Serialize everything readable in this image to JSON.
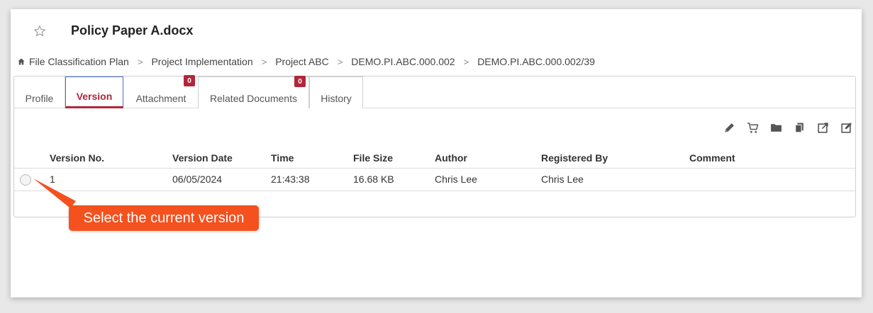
{
  "document": {
    "title": "Policy Paper A.docx"
  },
  "breadcrumb": [
    {
      "label": "File Classification Plan"
    },
    {
      "label": "Project Implementation"
    },
    {
      "label": "Project ABC"
    },
    {
      "label": "DEMO.PI.ABC.000.002"
    },
    {
      "label": "DEMO.PI.ABC.000.002/39"
    }
  ],
  "breadcrumb_separator": ">",
  "tabs": [
    {
      "label": "Profile"
    },
    {
      "label": "Version"
    },
    {
      "label": "Attachment",
      "badge": "0"
    },
    {
      "label": "Related Documents",
      "badge": "0"
    },
    {
      "label": "History"
    }
  ],
  "toolbar": {
    "icons": [
      "pencil-icon",
      "cart-icon",
      "folder-icon",
      "copy-icon",
      "checkout-icon",
      "edit-icon"
    ]
  },
  "table": {
    "columns": [
      "Version No.",
      "Version Date",
      "Time",
      "File Size",
      "Author",
      "Registered By",
      "Comment"
    ],
    "rows": [
      {
        "version": "1",
        "date": "06/05/2024",
        "time": "21:43:38",
        "size": "16.68 KB",
        "author": "Chris Lee",
        "registered_by": "Chris Lee",
        "comment": ""
      }
    ]
  },
  "callout": {
    "text": "Select the current version",
    "color": "#f4511e"
  },
  "colors": {
    "accent": "#b3263a",
    "active_tab_border": "#4a72c8"
  }
}
